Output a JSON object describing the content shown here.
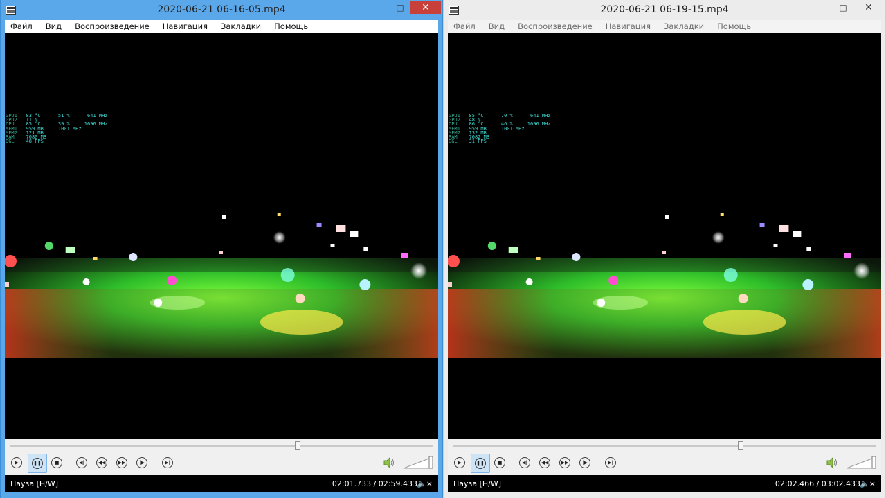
{
  "windows": [
    {
      "title": "2020-06-21 06-16-05.mp4",
      "menu": [
        "Файл",
        "Вид",
        "Воспроизведение",
        "Навигация",
        "Закладки",
        "Помощь"
      ],
      "stats": {
        "labels": [
          "GPU1",
          "GPU2",
          "CPU",
          "MEM1",
          "MEM2",
          "RAM",
          "OGL"
        ],
        "values": [
          "83 °C      51 %      641 MHz",
          "11 %",
          "85 °C      39 %     1696 MHz",
          "959 MB     1001 MHz",
          "121 MB",
          "7080 MB",
          "48 FPS"
        ]
      },
      "seek_fraction": 0.678,
      "status_left": "Пауза [H/W]",
      "status_time": "02:01.733 / 02:59.433",
      "focused": true
    },
    {
      "title": "2020-06-21 06-19-15.mp4",
      "menu": [
        "Файл",
        "Вид",
        "Воспроизведение",
        "Навигация",
        "Закладки",
        "Помощь"
      ],
      "stats": {
        "labels": [
          "GPU1",
          "GPU2",
          "CPU",
          "MEM1",
          "MEM2",
          "RAM",
          "OGL"
        ],
        "values": [
          "85 °C      70 %      641 MHz",
          "48 %",
          "86 °C      46 %     1696 MHz",
          "959 MB     1001 MHz",
          "132 MB",
          "7082 MB",
          "31 FPS"
        ]
      },
      "seek_fraction": 0.678,
      "status_left": "Пауза [H/W]",
      "status_time": "02:02.466 / 03:02.433",
      "focused": false
    }
  ],
  "icons": {
    "play": "play-icon",
    "pause": "pause-icon",
    "stop": "stop-icon",
    "prev": "skip-previous-icon",
    "rewind": "rewind-icon",
    "forward": "fast-forward-icon",
    "next": "skip-next-icon",
    "frame": "frame-step-icon",
    "volume": "speaker-icon",
    "mute": "mute-icon"
  },
  "colors": {
    "active_title_bg": "#5aa8ea",
    "inactive_title_bg": "#ececec",
    "close_button_active": "#c7403a"
  }
}
